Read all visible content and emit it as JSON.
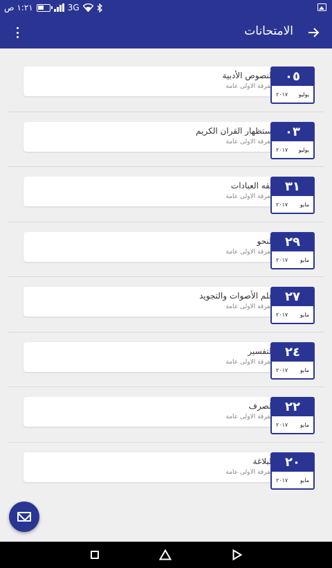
{
  "status_bar": {
    "time": "١:٢١ ص",
    "network": "3G",
    "icons": [
      "battery-icon",
      "signal-icon",
      "wifi-icon",
      "bluetooth-icon",
      "image-notification-icon"
    ]
  },
  "app_bar": {
    "title": "الامتحانات",
    "back_icon": "arrow-forward-icon",
    "menu_icon": "more-vert-icon"
  },
  "exams": [
    {
      "subject": "النصوص الأدبية",
      "grade": "الفرقة الاولى عامة",
      "day": "٠٥",
      "month": "يوليو",
      "year": "٢٠١٧"
    },
    {
      "subject": "استظهار القران الكريم",
      "grade": "الفرقة الاولى عامة",
      "day": "٠٣",
      "month": "يوليو",
      "year": "٢٠١٧"
    },
    {
      "subject": "فقه العبادات",
      "grade": "الفرقة الاولى عامة",
      "day": "٣١",
      "month": "مايو",
      "year": "٢٠١٧"
    },
    {
      "subject": "النحو",
      "grade": "الفرقة الاولى عامة",
      "day": "٢٩",
      "month": "مايو",
      "year": "٢٠١٧"
    },
    {
      "subject": "علم الأصوات والتجويد",
      "grade": "الفرقة الاولى عامة",
      "day": "٢٧",
      "month": "مايو",
      "year": "٢٠١٧"
    },
    {
      "subject": "التفسير",
      "grade": "الفرقة الاولى عامة",
      "day": "٢٤",
      "month": "مايو",
      "year": "٢٠١٧"
    },
    {
      "subject": "الصرف",
      "grade": "الفرقة الاولى عامة",
      "day": "٢٢",
      "month": "مايو",
      "year": "٢٠١٧"
    },
    {
      "subject": "البلاغة",
      "grade": "الفرقة الاولى عامة",
      "day": "٢٠",
      "month": "مايو",
      "year": "٢٠١٧"
    }
  ],
  "fab": {
    "icon": "email-icon"
  },
  "nav_bar": {
    "icons": [
      "recents-icon",
      "home-icon",
      "back-icon"
    ]
  },
  "colors": {
    "primary": "#2a3593",
    "background": "#efefef",
    "card": "#ffffff",
    "divider": "#d9d9d9"
  }
}
